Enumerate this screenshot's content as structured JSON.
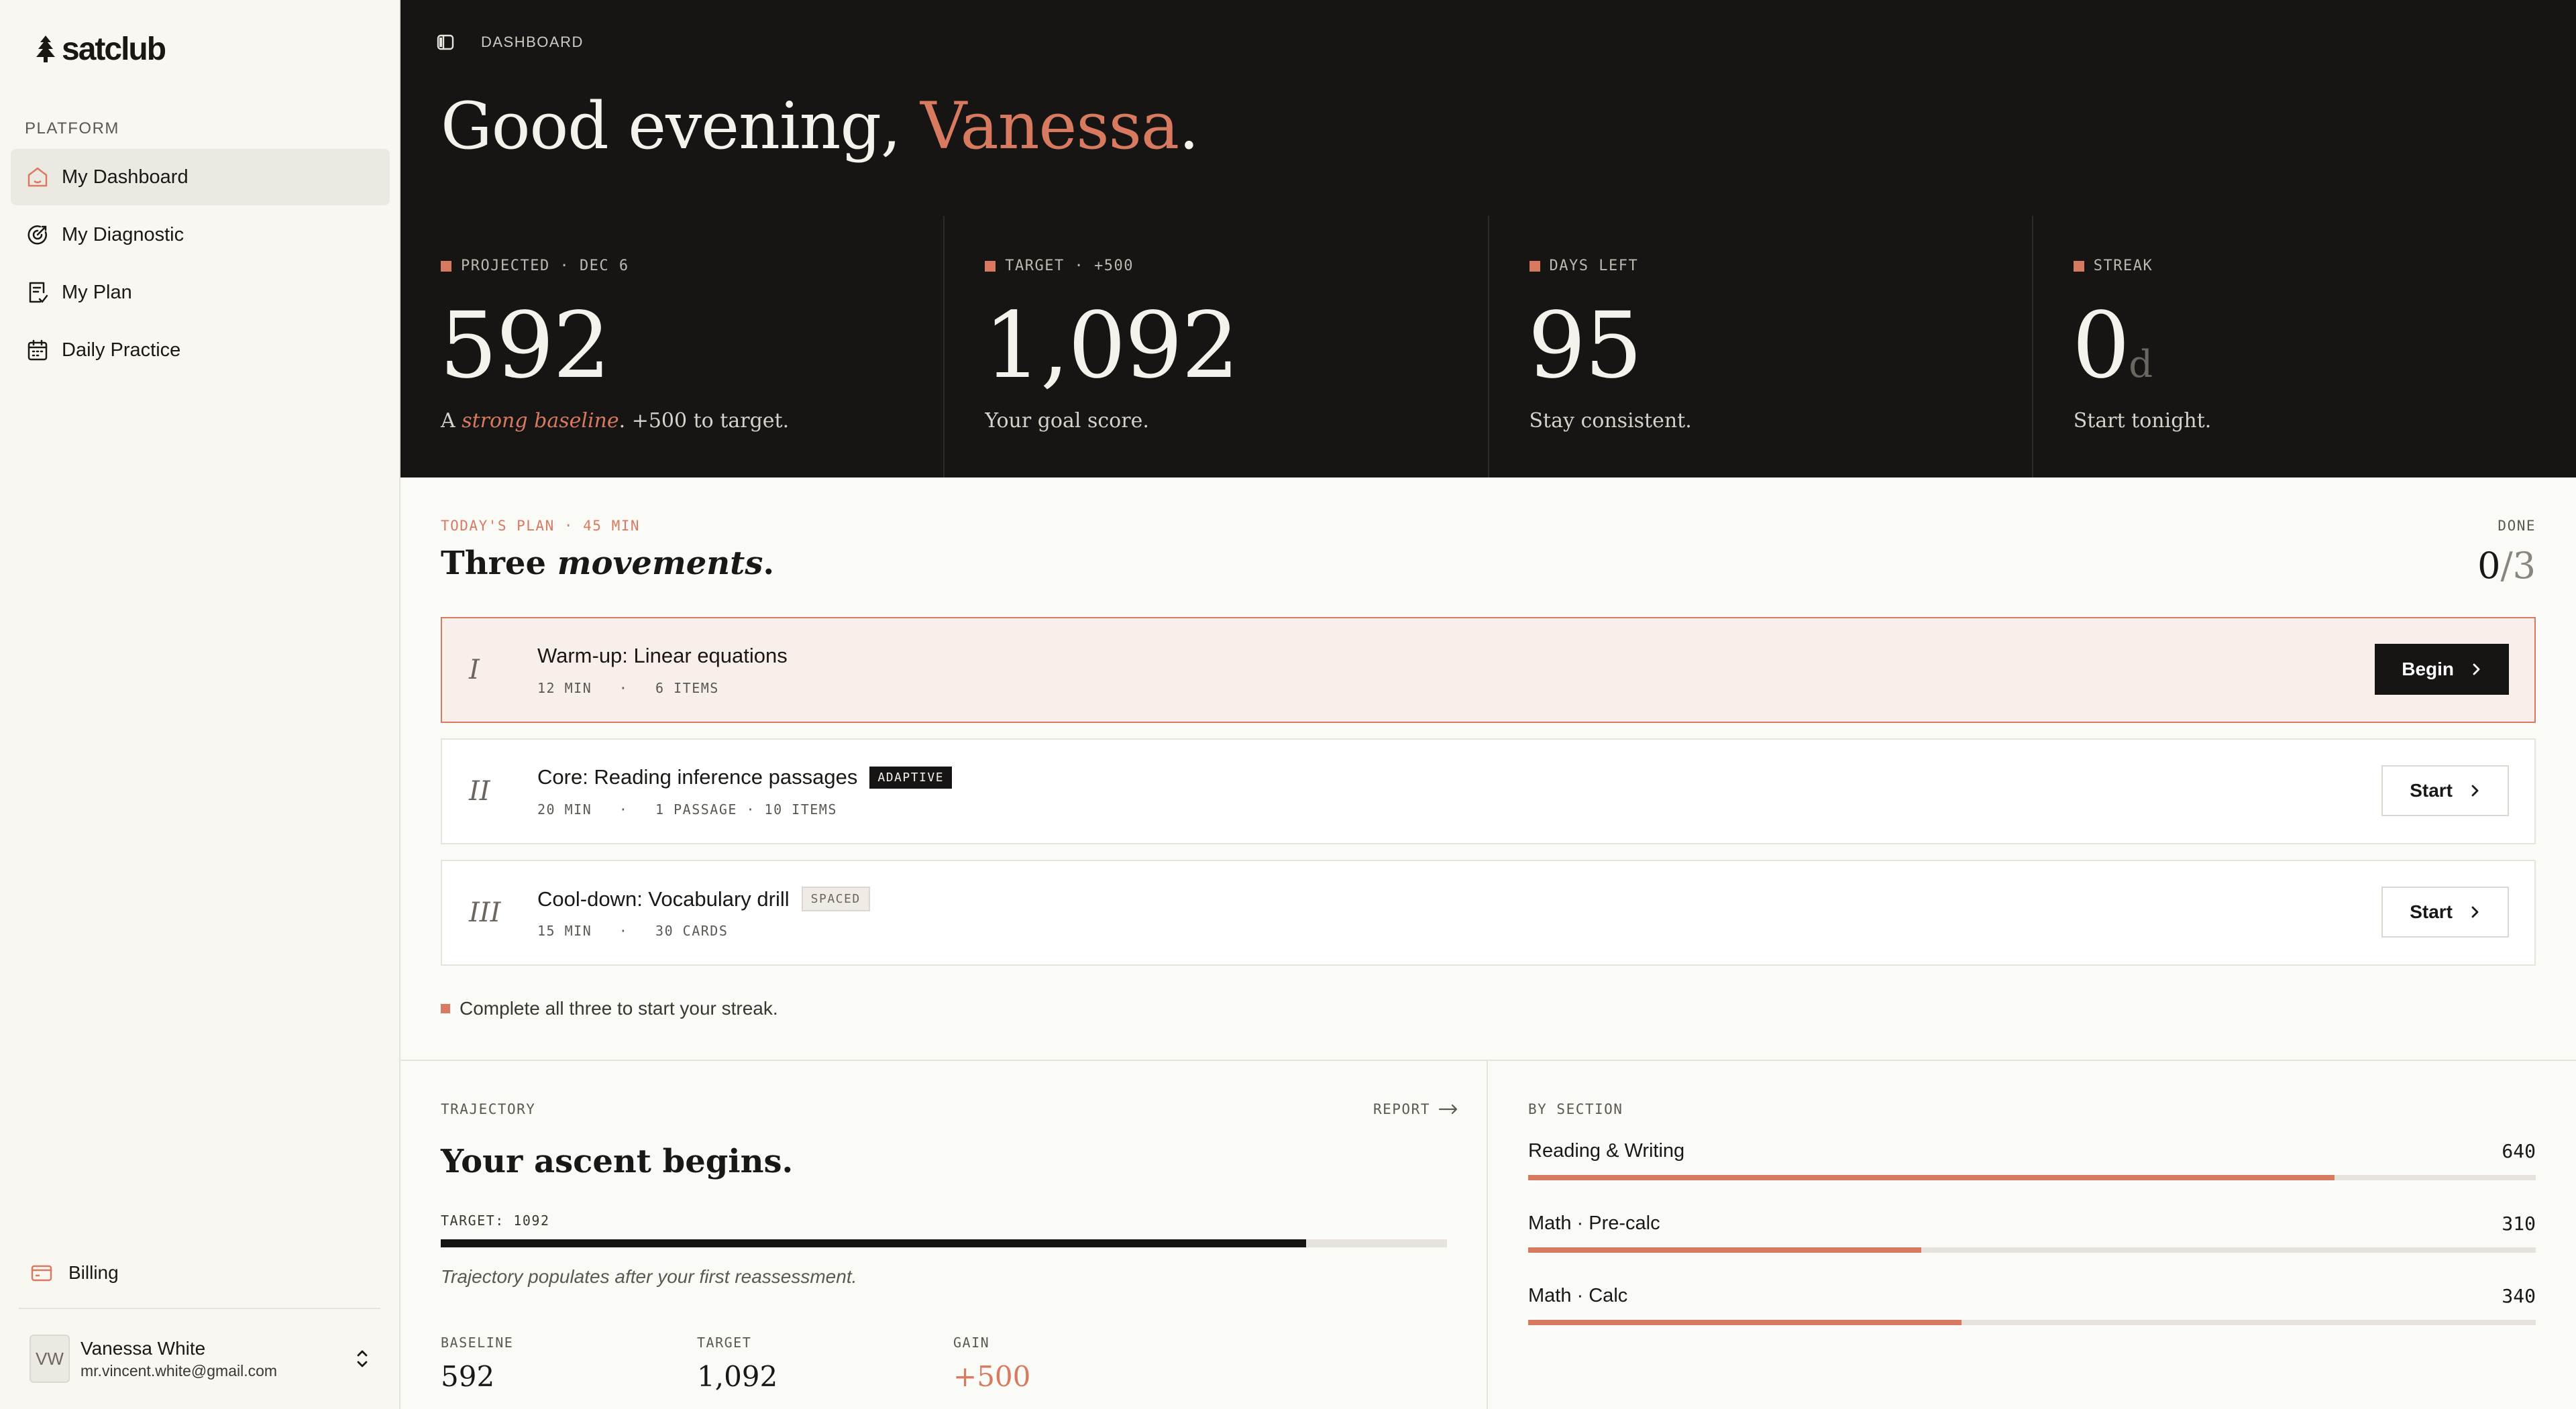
{
  "brand": {
    "name": "satclub"
  },
  "sidebar": {
    "section_label": "PLATFORM",
    "items": [
      {
        "label": "My Dashboard",
        "icon": "home-icon",
        "active": true
      },
      {
        "label": "My Diagnostic",
        "icon": "target-icon",
        "active": false
      },
      {
        "label": "My Plan",
        "icon": "plan-icon",
        "active": false
      },
      {
        "label": "Daily Practice",
        "icon": "calendar-icon",
        "active": false
      }
    ],
    "billing_label": "Billing",
    "user": {
      "initials": "VW",
      "name": "Vanessa White",
      "email": "mr.vincent.white@gmail.com"
    }
  },
  "header": {
    "breadcrumb": "DASHBOARD",
    "greeting_prefix": "Good evening, ",
    "greeting_name": "Vanessa",
    "greeting_suffix": "."
  },
  "stats": [
    {
      "label": "PROJECTED · DEC 6",
      "value": "592",
      "unit": "",
      "sub_prefix": "A ",
      "sub_em": "strong baseline",
      "sub_suffix": ". +500 to target."
    },
    {
      "label": "TARGET · +500",
      "value": "1,092",
      "unit": "",
      "sub_prefix": "Your goal score.",
      "sub_em": "",
      "sub_suffix": ""
    },
    {
      "label": "DAYS LEFT",
      "value": "95",
      "unit": "",
      "sub_prefix": "Stay consistent.",
      "sub_em": "",
      "sub_suffix": ""
    },
    {
      "label": "STREAK",
      "value": "0",
      "unit": "d",
      "sub_prefix": "Start tonight.",
      "sub_em": "",
      "sub_suffix": ""
    }
  ],
  "plan": {
    "kicker": "TODAY'S PLAN · 45 MIN",
    "title_prefix": "Three ",
    "title_em": "movements",
    "title_suffix": ".",
    "done_label": "DONE",
    "done_count": "0",
    "done_total": "/3",
    "movements": [
      {
        "numeral": "I",
        "title": "Warm-up: Linear equations",
        "badge": "",
        "meta": "12 MIN   ·   6 ITEMS",
        "button": "Begin"
      },
      {
        "numeral": "II",
        "title": "Core: Reading inference passages",
        "badge": "ADAPTIVE",
        "meta": "20 MIN   ·   1 PASSAGE · 10 ITEMS",
        "button": "Start"
      },
      {
        "numeral": "III",
        "title": "Cool-down: Vocabulary drill",
        "badge": "SPACED",
        "meta": "15 MIN   ·   30 CARDS",
        "button": "Start"
      }
    ],
    "note": "Complete all three to start your streak."
  },
  "trajectory": {
    "kicker": "TRAJECTORY",
    "report_label": "REPORT",
    "title": "Your ascent begins.",
    "target_label": "TARGET: 1092",
    "progress": 0.86,
    "note": "Trajectory populates after your first reassessment.",
    "stats": [
      {
        "label": "BASELINE",
        "value": "592"
      },
      {
        "label": "TARGET",
        "value": "1,092"
      },
      {
        "label": "GAIN",
        "value": "+500"
      }
    ]
  },
  "by_section": {
    "kicker": "BY SECTION",
    "rows": [
      {
        "name": "Reading & Writing",
        "score": "640",
        "fraction": 0.8
      },
      {
        "name": "Math · Pre-calc",
        "score": "310",
        "fraction": 0.39
      },
      {
        "name": "Math · Calc",
        "score": "340",
        "fraction": 0.43
      }
    ]
  },
  "colors": {
    "accent": "#d87a60",
    "dark": "#171513",
    "surface": "#fafaf7"
  }
}
